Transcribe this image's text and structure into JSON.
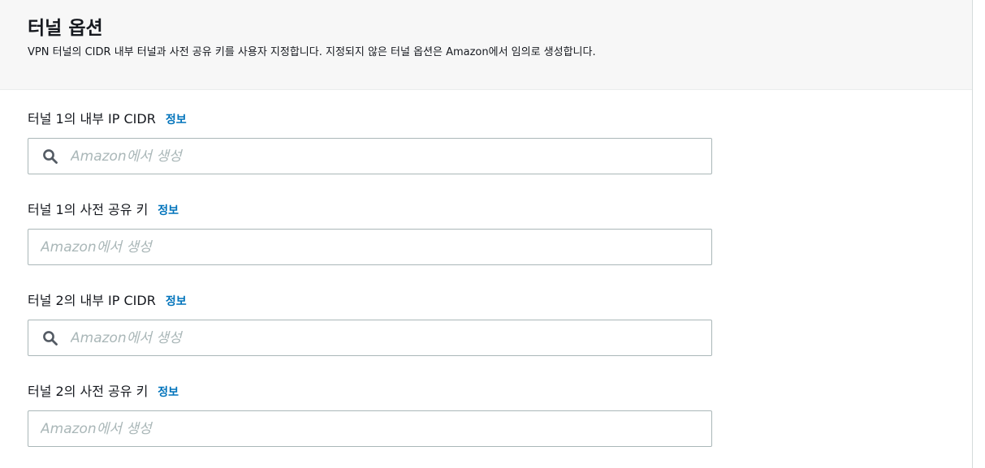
{
  "section": {
    "title": "터널 옵션",
    "description": "VPN 터널의 CIDR 내부 터널과 사전 공유 키를 사용자 지정합니다. 지정되지 않은 터널 옵션은 Amazon에서 임의로 생성합니다."
  },
  "fields": [
    {
      "label": "터널 1의 내부 IP CIDR",
      "info": "정보",
      "placeholder": "Amazon에서 생성",
      "value": "",
      "icon": "search-icon"
    },
    {
      "label": "터널 1의 사전 공유 키",
      "info": "정보",
      "placeholder": "Amazon에서 생성",
      "value": ""
    },
    {
      "label": "터널 2의 내부 IP CIDR",
      "info": "정보",
      "placeholder": "Amazon에서 생성",
      "value": "",
      "icon": "search-icon"
    },
    {
      "label": "터널 2의 사전 공유 키",
      "info": "정보",
      "placeholder": "Amazon에서 생성",
      "value": ""
    }
  ],
  "colors": {
    "info_link": "#0073bb",
    "placeholder": "#aab7b8",
    "header_bg": "#f7f7f7",
    "input_border": "#aab7b8"
  }
}
